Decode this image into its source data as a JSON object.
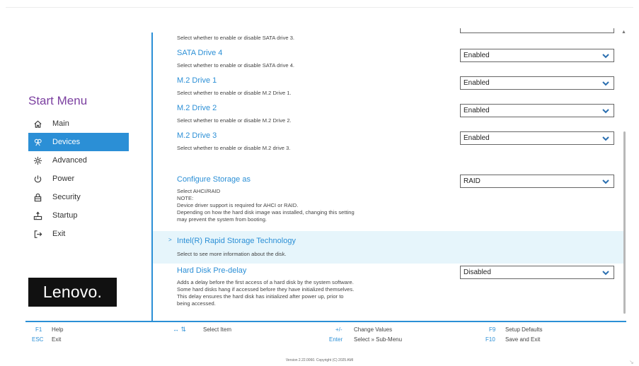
{
  "sidebar": {
    "title": "Start Menu",
    "items": [
      {
        "label": "Main",
        "icon": "home-icon"
      },
      {
        "label": "Devices",
        "icon": "devices-icon"
      },
      {
        "label": "Advanced",
        "icon": "advanced-icon"
      },
      {
        "label": "Power",
        "icon": "power-icon"
      },
      {
        "label": "Security",
        "icon": "lock-icon"
      },
      {
        "label": "Startup",
        "icon": "startup-icon"
      },
      {
        "label": "Exit",
        "icon": "exit-icon"
      }
    ],
    "active_index": 1,
    "logo": "Lenovo."
  },
  "settings": {
    "sata3": {
      "desc": "Select whether to enable or disable SATA drive 3."
    },
    "sata4": {
      "title": "SATA Drive 4",
      "desc": "Select whether to enable or disable SATA drive 4.",
      "value": "Enabled"
    },
    "m2_1": {
      "title": "M.2 Drive 1",
      "desc": "Select whether to enable or disable M.2 Drive 1.",
      "value": "Enabled"
    },
    "m2_2": {
      "title": "M.2 Drive 2",
      "desc": "Select whether to enable or disable M.2 Drive 2.",
      "value": "Enabled"
    },
    "m2_3": {
      "title": "M.2 Drive 3",
      "desc": "Select whether to enable or disable M.2 drive 3.",
      "value": "Enabled"
    },
    "storage": {
      "title": "Configure Storage as",
      "desc_lines": [
        "Select AHCI/RAID",
        "NOTE:",
        "Device driver support is required  for AHCI or RAID.",
        "Depending on how the hard disk image was installed, changing this setting",
        "may prevent the system from booting."
      ],
      "value": "RAID"
    },
    "rst": {
      "arrow": ">",
      "title": "Intel(R) Rapid Storage Technology",
      "desc": "Select to see more information about the disk."
    },
    "predelay": {
      "title": "Hard Disk Pre-delay",
      "desc_lines": [
        "Adds a delay before the first access of a hard disk by the system software.",
        "Some hard disks hang if accessed before they have initialized themselves.",
        "This delay ensures the hard disk has initialized after power up, prior to",
        "being accessed."
      ],
      "value": "Disabled"
    }
  },
  "footer": {
    "hotkeys": [
      {
        "key": "F1",
        "label": "Help"
      },
      {
        "key": "ESC",
        "label": "Exit"
      },
      {
        "key": "↔ ⇅",
        "label": "Select Item"
      },
      {
        "key": "+/-",
        "label": "Change Values"
      },
      {
        "key": "Enter",
        "label": "Select » Sub-Menu"
      },
      {
        "key": "F9",
        "label": "Setup Defaults"
      },
      {
        "key": "F10",
        "label": "Save and Exit"
      }
    ],
    "version": "Version 2.22.0060. Copyright (C) 2025 AMI"
  },
  "colors": {
    "accent": "#2b8fd6",
    "title_purple": "#7b3fa0",
    "highlight": "#e6f5fb"
  }
}
